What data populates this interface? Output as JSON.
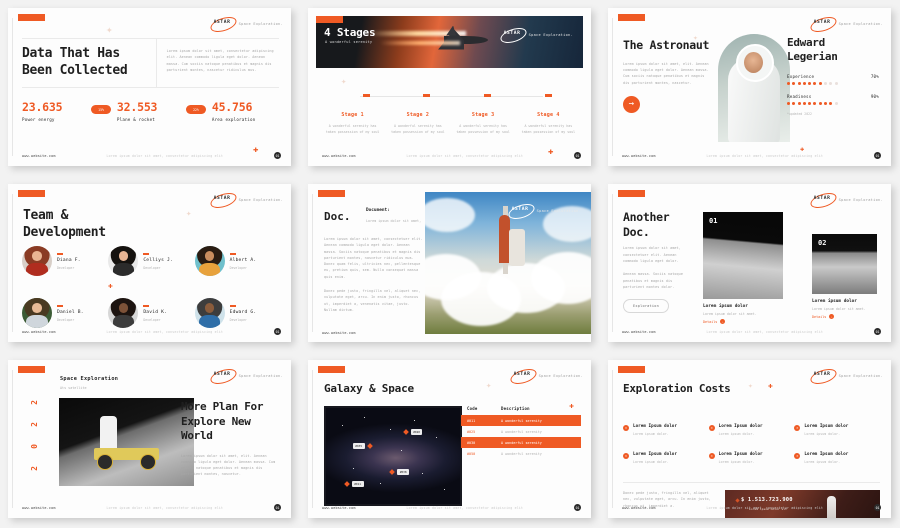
{
  "brand": {
    "logo_text": "ASTAR",
    "logo_sub": "Space Exploration.",
    "accent": "#ef5a24",
    "dark": "#1f1f1f",
    "muted": "#b0b0b0"
  },
  "footer": {
    "url": "www.website.com",
    "center": "Lorem ipsum dolor sit amet, consectetur adipiscing elit",
    "page": "01"
  },
  "slides": [
    {
      "id": "data-collected",
      "title": "Data That Has Been Collected",
      "body": "Lorem ipsum dolor sit amet, consectetur adipiscing elit. Aenean commodo ligula eget dolor. Aenean massa. Cum sociis natoque penatibus et magnis dis parturient montes, nascetur ridiculus mus.",
      "stats": [
        {
          "number": "23.635",
          "label": "Power energy"
        },
        {
          "number": "32.553",
          "label": "Plane & rocket"
        },
        {
          "number": "45.756",
          "label": "Area exploration"
        }
      ],
      "pills": [
        "15%",
        "22%"
      ]
    },
    {
      "id": "four-stages",
      "title": "4 Stages",
      "subtitle": "A wonderful serenity",
      "stages": [
        {
          "title": "Stage 1",
          "desc": "A wonderful serenity has taken possession of my soul"
        },
        {
          "title": "Stage 2",
          "desc": "A wonderful serenity has taken possession of my soul"
        },
        {
          "title": "Stage 3",
          "desc": "A wonderful serenity has taken possession of my soul"
        },
        {
          "title": "Stage 4",
          "desc": "A wonderful serenity has taken possession of my soul"
        }
      ]
    },
    {
      "id": "the-astronaut",
      "title": "The Astronaut",
      "body": "Lorem ipsum dolor sit amet, elit. Aenean commodo ligula eget dolor. Aenean massa. Cum sociis natoque penatibus et magnis dis parturient montes, nascetur.",
      "arrow": "→",
      "person_name": "Edward Legerian",
      "ratings": [
        {
          "label": "Experience",
          "value": "70%",
          "filled": 7,
          "total": 10
        },
        {
          "label": "Readiness",
          "value": "90%",
          "filled": 9,
          "total": 10
        }
      ],
      "note": "*updated 2022"
    },
    {
      "id": "team-development",
      "title": "Team & Development",
      "members": [
        {
          "name": "Diana F.",
          "role": "Developer",
          "hair": "#8a3b24",
          "skin": "#e9b493",
          "cloth": "#b02d1f",
          "bg": "#d8cfc8"
        },
        {
          "name": "Celliys J.",
          "role": "Developer",
          "hair": "#15120f",
          "skin": "#e6b493",
          "cloth": "#2b2b2b",
          "bg": "#e9e9e9"
        },
        {
          "name": "Albert A.",
          "role": "Developer",
          "hair": "#2a1c12",
          "skin": "#c98d5e",
          "cloth": "#e8a23c",
          "bg": "#6fc0cc"
        },
        {
          "name": "Daniel B.",
          "role": "Developer",
          "hair": "#4a3a22",
          "skin": "#e8bb97",
          "cloth": "#cfd6dc",
          "bg": "#3c5c36"
        },
        {
          "name": "David K.",
          "role": "Developer",
          "hair": "#1d1410",
          "skin": "#7d5238",
          "cloth": "#3c3c3c",
          "bg": "#d7d7d7"
        },
        {
          "name": "Edward G.",
          "role": "Developer",
          "hair": "#3d3d3d",
          "skin": "#8a5c3c",
          "cloth": "#2f6ea8",
          "bg": "#cfe2ea"
        }
      ]
    },
    {
      "id": "doc",
      "title": "Doc.",
      "doc_label": "Document:",
      "doc_sub": "Lorem ipsum dolor sit amet,",
      "para1": "Lorem ipsum dolor sit amet, consectetuer elit. Aenean commodo ligula eget dolor. Aenean massa. Sociis natoque penatibus et magnis dis parturient montes, nascetur ridiculus mus. Donec quam felis, ultricies nec, pellentesque eu, pretium quis, sem. Nulla consequat massa quis enim.",
      "para2": "Donec pede justo, fringilla vel, aliquet nec, vulputate eget, arcu. In enim justo, rhoncus ut, imperdiet a, venenatis vitae, justo. Nullam dictum."
    },
    {
      "id": "another-doc",
      "title": "Another Doc.",
      "para1": "Lorem ipsum dolor sit amet, consectetuer elit. Aenean commodo ligula eget dolor.",
      "para2": "Aenean massa. Sociis natoque penatibus et magnis dis parturient montes dolor.",
      "button": "Exploration",
      "cards": [
        {
          "number": "01",
          "title": "Lorem ipsum dolor",
          "desc": "Lorem ipsum dolor sit amet.",
          "link": "Details"
        },
        {
          "number": "02",
          "title": "Lorem ipsum dolor",
          "desc": "Lorem ipsum dolor sit amet.",
          "link": "Details"
        }
      ]
    },
    {
      "id": "more-plan",
      "header_title": "Space Exploration",
      "header_sub": "Ats satellite",
      "year_digits": [
        "2",
        "2",
        "0",
        "2"
      ],
      "title": "More Plan For Explore New World",
      "body": "Lorem ipsum dolor sit amet, elit. Aenean commodo ligula eget dolor. Aenean massa. Cum sociis natoque penatibus et magnis dis parturient montes, nascetur."
    },
    {
      "id": "galaxy-space",
      "title": "Galaxy & Space",
      "markers": [
        "#020",
        "#035",
        "#038",
        "#011"
      ],
      "table": {
        "headers": [
          "Code",
          "Description"
        ],
        "rows": [
          {
            "code": "#011",
            "desc": "A wonderful serenity",
            "highlight": true
          },
          {
            "code": "#025",
            "desc": "A wonderful serenity",
            "highlight": false
          },
          {
            "code": "#030",
            "desc": "A wonderful serenity",
            "highlight": true
          },
          {
            "code": "#050",
            "desc": "A wonderful serenity",
            "highlight": false
          }
        ]
      }
    },
    {
      "id": "exploration-costs",
      "title": "Exploration Costs",
      "items": [
        {
          "title": "Lorem Ipsum dolor",
          "desc": "Lorem ipsum dolor."
        },
        {
          "title": "Lorem Ipsum dolor",
          "desc": "Lorem ipsum dolor."
        },
        {
          "title": "Lorem Ipsum dolor",
          "desc": "Lorem ipsum dolor."
        },
        {
          "title": "Lorem Ipsum dolor",
          "desc": "Lorem ipsum dolor."
        },
        {
          "title": "Lorem Ipsum dolor",
          "desc": "Lorem ipsum dolor."
        },
        {
          "title": "Lorem Ipsum dolor",
          "desc": "Lorem ipsum dolor."
        }
      ],
      "note": "Donec pede justo, fringilla vel, aliquet nec, vulputate eget, arcu. In enim justo, rhoncus ut, imperdiet a.",
      "amount": "$ 1.513.723.900",
      "amount_sub": "Lorem ipsum dolor sit"
    }
  ]
}
